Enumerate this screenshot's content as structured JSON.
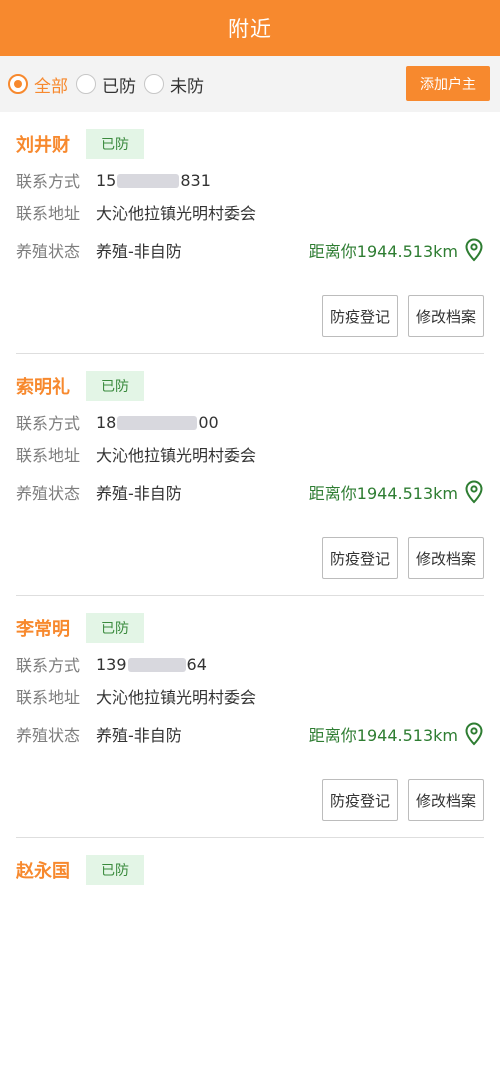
{
  "header": {
    "title": "附近"
  },
  "filters": {
    "options": [
      "全部",
      "已防",
      "未防"
    ],
    "selected": "全部",
    "add_button": "添加户主"
  },
  "labels": {
    "contact": "联系方式",
    "address": "联系地址",
    "status": "养殖状态",
    "register_btn": "防疫登记",
    "edit_btn": "修改档案"
  },
  "farmers": [
    {
      "name": "刘井财",
      "badge": "已防",
      "phone_prefix": "15",
      "phone_suffix": "831",
      "address": "大沁他拉镇光明村委会",
      "status": "养殖-非自防",
      "distance": "距离你1944.513km"
    },
    {
      "name": "索明礼",
      "badge": "已防",
      "phone_prefix": "18",
      "phone_suffix": "00",
      "address": "大沁他拉镇光明村委会",
      "status": "养殖-非自防",
      "distance": "距离你1944.513km"
    },
    {
      "name": "李常明",
      "badge": "已防",
      "phone_prefix": "139",
      "phone_suffix": "64",
      "address": "大沁他拉镇光明村委会",
      "status": "养殖-非自防",
      "distance": "距离你1944.513km"
    },
    {
      "name": "赵永国",
      "badge": "已防"
    }
  ],
  "colors": {
    "accent": "#f7892e",
    "badge_bg": "#e3f5e6",
    "distance": "#2e7d32"
  },
  "icons": {
    "location": "map-pin-icon"
  }
}
